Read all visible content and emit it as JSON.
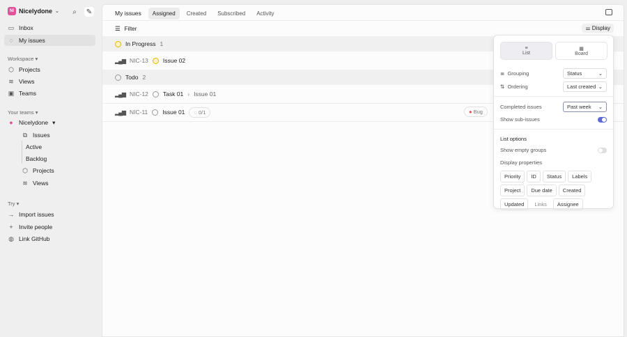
{
  "sidebar": {
    "workspace": "Nicelydone",
    "workspace_initials": "NI",
    "inbox": "Inbox",
    "my_issues": "My issues",
    "workspace_label": "Workspace",
    "projects": "Projects",
    "views": "Views",
    "teams": "Teams",
    "your_teams": "Your teams",
    "team": "Nicelydone",
    "issues": "Issues",
    "active": "Active",
    "backlog": "Backlog",
    "team_projects": "Projects",
    "team_views": "Views",
    "try": "Try",
    "import": "Import issues",
    "invite": "Invite people",
    "github": "Link GitHub"
  },
  "header": {
    "title": "My issues",
    "tabs": [
      "Assigned",
      "Created",
      "Subscribed",
      "Activity"
    ],
    "filter": "Filter",
    "display": "Display"
  },
  "groups": [
    {
      "name": "In Progress",
      "count": "1"
    },
    {
      "name": "Todo",
      "count": "2"
    }
  ],
  "issues": [
    {
      "id": "NIC-13",
      "title": "Issue 02"
    },
    {
      "id": "NIC-12",
      "title": "Task 01",
      "parent": "Issue 01"
    },
    {
      "id": "NIC-11",
      "title": "Issue 01",
      "subs": "0/1",
      "label": "Bug"
    }
  ],
  "display": {
    "list": "List",
    "board": "Board",
    "grouping": "Grouping",
    "grouping_value": "Status",
    "ordering": "Ordering",
    "ordering_value": "Last created",
    "completed": "Completed issues",
    "completed_value": "Past week",
    "show_sub": "Show sub-issues",
    "list_options": "List options",
    "show_empty": "Show empty groups",
    "props_label": "Display properties",
    "props": [
      "Priority",
      "ID",
      "Status",
      "Labels",
      "Project",
      "Due date",
      "Created",
      "Updated",
      "Links",
      "Assignee"
    ]
  },
  "colors": {
    "accent": "#5e6ad2",
    "bug": "#e5484d"
  }
}
